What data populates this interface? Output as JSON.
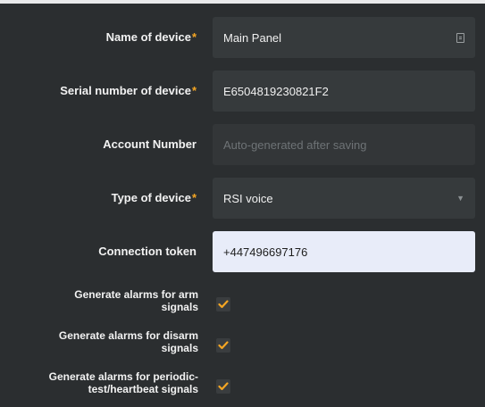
{
  "form": {
    "device_name": {
      "label": "Name of device",
      "required": "*",
      "value": "Main Panel",
      "icon": "document-icon"
    },
    "serial_number": {
      "label": "Serial number of device",
      "required": "*",
      "value": "E6504819230821F2"
    },
    "account_number": {
      "label": "Account Number",
      "placeholder": "Auto-generated after saving"
    },
    "device_type": {
      "label": "Type of device",
      "required": "*",
      "value": "RSI voice",
      "icon": "chevron-down-icon"
    },
    "connection_token": {
      "label": "Connection token",
      "value": "+447496697176"
    },
    "checkboxes": [
      {
        "line1": "Generate alarms for arm",
        "line2": "signals",
        "checked": true
      },
      {
        "line1": "Generate alarms for disarm",
        "line2": "signals",
        "checked": true
      },
      {
        "line1": "Generate alarms for periodic-",
        "line2": "test/heartbeat signals",
        "checked": true
      }
    ]
  },
  "colors": {
    "background": "#2b2e30",
    "field": "#363a3c",
    "focused_field": "#e8ecf9",
    "accent": "#f5a623"
  }
}
